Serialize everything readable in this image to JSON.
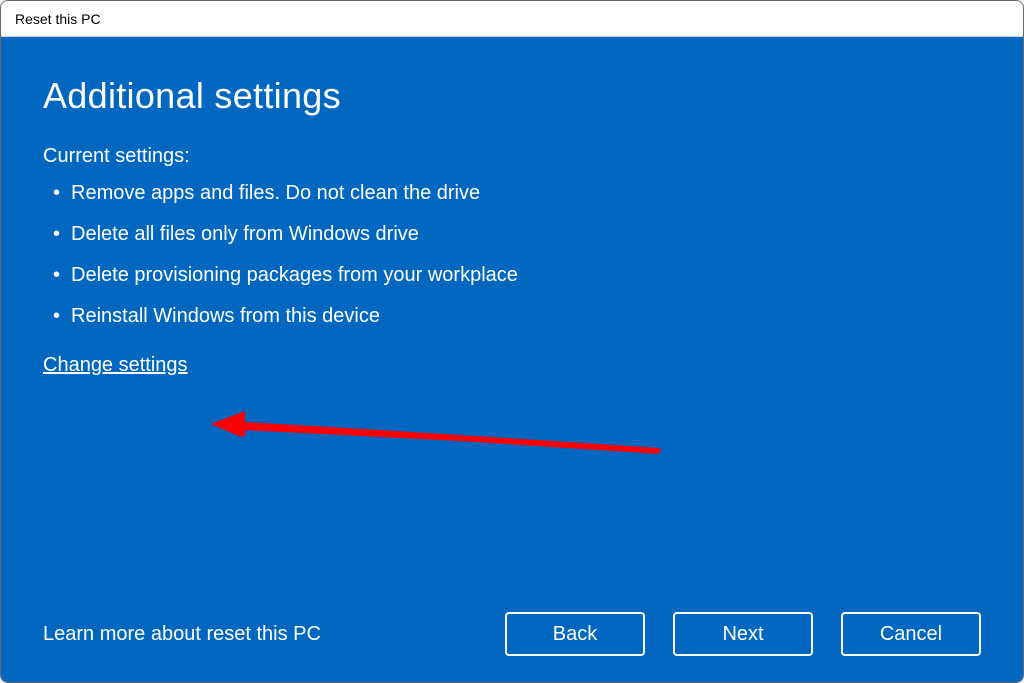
{
  "window": {
    "title": "Reset this PC"
  },
  "page": {
    "heading": "Additional settings",
    "subheading": "Current settings:",
    "settings": [
      "Remove apps and files. Do not clean the drive",
      "Delete all files only from Windows drive",
      "Delete provisioning packages from your workplace",
      "Reinstall Windows from this device"
    ],
    "change_link": "Change settings",
    "learn_more": "Learn more about reset this PC"
  },
  "buttons": {
    "back": "Back",
    "next": "Next",
    "cancel": "Cancel"
  },
  "colors": {
    "accent": "#0067c0",
    "annotation": "#ff0000"
  }
}
